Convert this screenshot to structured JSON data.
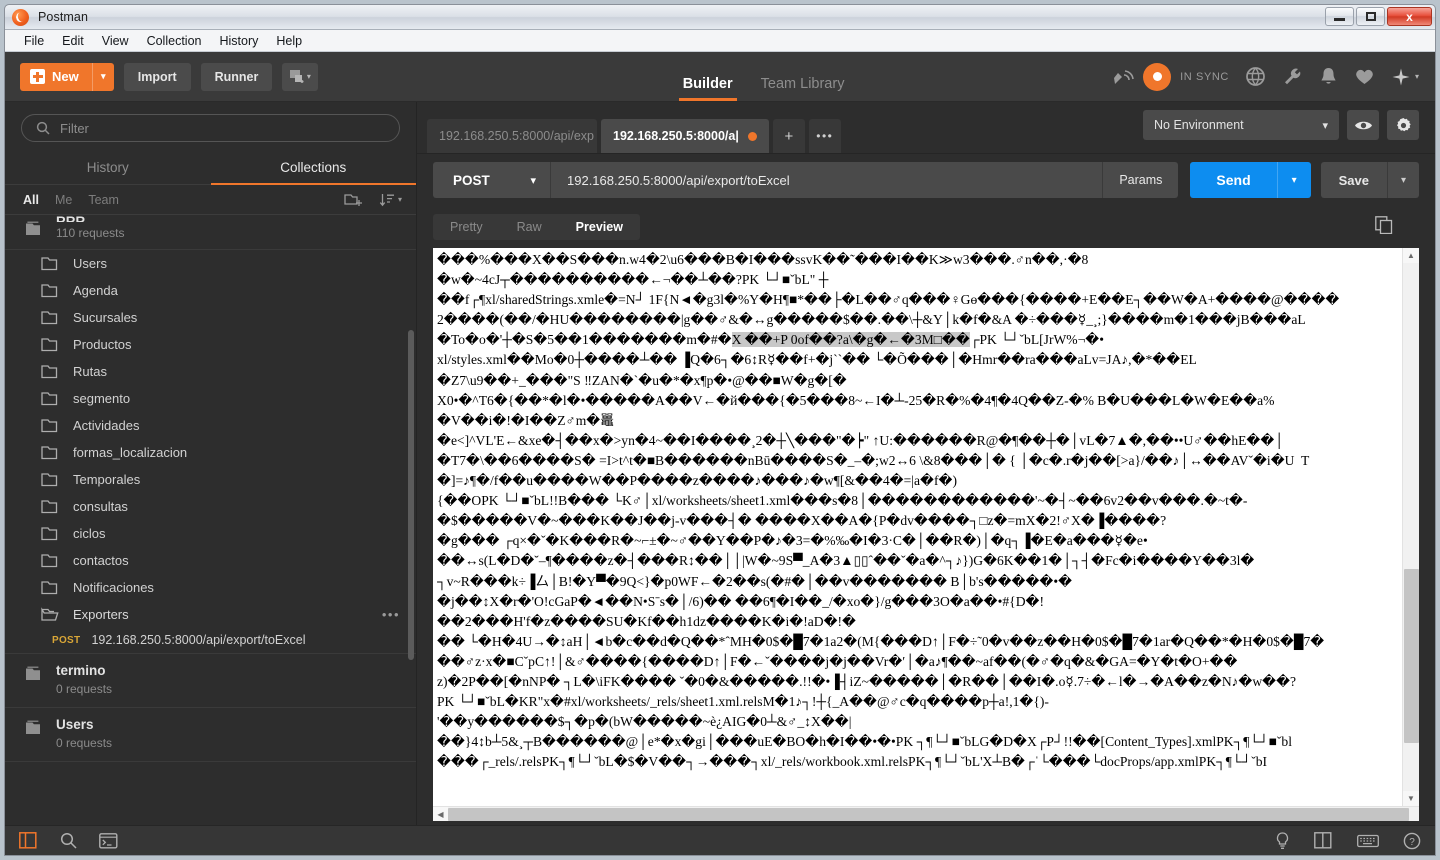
{
  "window": {
    "title": "Postman",
    "app_icon": "postman-logo-icon",
    "controls": {
      "minimize": "minimize-icon",
      "maximize": "restore-icon",
      "close": "x"
    }
  },
  "menubar": {
    "items": [
      "File",
      "Edit",
      "View",
      "Collection",
      "History",
      "Help"
    ]
  },
  "toolbar": {
    "new_label": "New",
    "new_caret": "▾",
    "import_label": "Import",
    "runner_label": "Runner",
    "tabs": [
      {
        "label": "Builder",
        "active": true
      },
      {
        "label": "Team Library",
        "active": false
      }
    ],
    "sync_status": "IN SYNC",
    "icons": [
      "satellite-icon",
      "sync-status-icon",
      "globe-icon",
      "wrench-icon",
      "bell-icon",
      "heart-icon",
      "upgrade-plus-icon"
    ]
  },
  "sidebar": {
    "filter_placeholder": "Filter",
    "tabs": [
      {
        "label": "History",
        "active": false
      },
      {
        "label": "Collections",
        "active": true
      }
    ],
    "scope_filters": [
      {
        "label": "All",
        "active": true
      },
      {
        "label": "Me",
        "active": false
      },
      {
        "label": "Team",
        "active": false
      }
    ],
    "header_icons": [
      "new-folder-icon",
      "sort-icon"
    ],
    "collections": [
      {
        "name": "RRR",
        "meta": "110 requests",
        "clipped": true,
        "folders": [
          "Users",
          "Agenda",
          "Sucursales",
          "Productos",
          "Rutas",
          "segmento",
          "Actividades",
          "formas_localizacion",
          "Temporales",
          "consultas",
          "ciclos",
          "contactos",
          "Notificaciones"
        ],
        "open_folder": {
          "name": "Exporters",
          "overflow": "•••",
          "requests": [
            {
              "method": "POST",
              "url": "192.168.250.5:8000/api/export/toExcel"
            }
          ]
        }
      },
      {
        "name": "termino",
        "meta": "0 requests",
        "folders": []
      },
      {
        "name": "Users",
        "meta": "0 requests",
        "folders": []
      }
    ]
  },
  "request_tabs": {
    "items": [
      {
        "label": "192.168.250.5:8000/api/exp",
        "active": false,
        "unsaved": false
      },
      {
        "label": "192.168.250.5:8000/a|",
        "active": true,
        "unsaved": true
      }
    ],
    "add_label": "+",
    "more_label": "•••"
  },
  "environment": {
    "selected": "No Environment",
    "caret": "⌄",
    "eye_icon": "eye-icon",
    "gear_icon": "gear-icon"
  },
  "request": {
    "method": "POST",
    "method_caret": "⌄",
    "url": "192.168.250.5:8000/api/export/toExcel",
    "params_label": "Params",
    "send_label": "Send",
    "send_caret": "⌄",
    "save_label": "Save",
    "save_caret": "⌄"
  },
  "response": {
    "view_tabs": [
      {
        "label": "Pretty",
        "active": false
      },
      {
        "label": "Raw",
        "active": false
      },
      {
        "label": "Preview",
        "active": true
      }
    ],
    "copy_icon": "copy-icon",
    "binary_lines": [
      "���%���X��S���n.w4�2\\u6���B�I���ssvK��˜���I��K≫w3���.♂n��,·�8",
      "�w�~4cJ┬����������←¬��┴��?PK └┘■ˇbL\" ┼",
      "��f┌¶xl/sharedStrings.xmle�=N┘ 1F{N◄�g3l�%Y�H¶■*��├�L��♂q���♀Gɵ���{����+E��E┐��W�A+����@����",
      "2����(��/�HU��������|g��♂&�↔g�����$��.��\\┼&Y│k�f�&A �÷���☿_¸;}����m�1���jB���aL",
      "�To�o�'┼�S�5��1�������m�#�<sel>X ��+P 0of��?a\\�g�←�3M□��</sel>┌PK └┘ˇbL[JrW%¬�•",
      "xl/styles.xml��Mo�0┼����┴�� ▐Q�6┐�6↕R☿��f+�j``�� └�Õ���│�Hmr��ra���aLv=JA♪,�*��EL",
      "�Z7\\u9��+_���\"S ‼ZAN�`�u�*�x¶p�•@��■W�g�[�",
      "X0•�^T6�{��*�l�•�����A��V←�й���{�5���8~←I�┴-25�R�%�4¶�4Q��Z-�% B�U���L�W�E��a%",
      "�V��i�!�I��Z♂m�鼉",
      "�e<]^VL'E←&xe�┤��x�>yn�4~��I����¸2�┼╲���\"�┝\" ↑U:������R@�¶��┼�│vL�7▲�,��••U♂��hE��│",
      "�T7�\\��6����S� =I>t^t�■B������nBū����S�_–�;w2↔6 \\&8���│� { │�c�.r�j��[>a}/��♪│↔��AVˇ�i�U  T",
      "�]=♪¶�/f��u����W��P����z����♪���♪�w¶[&��4�=|a�f�)",
      "{��OPK └┘■ˇbL!!B��� └K♂│xl/worksheets/sheet1.xml���s�8│������������'~�┤~��6v2��v���.�~t�-",
      "�$�����V�~���K��J��j-v���┤� ����X��A�{P�dv����┐□z�=mX�2!♂X�▐����?",
      "�g��� ┌q×�ˇ�K���R�~⌐±�~♂��Y��P�♪�3=�%‰�I�3·C�│��R�)│�q┐▐�E�a���☿�e•",
      "��↔s(L�D�˘–¶����z�┤���R↕��││|W�~9S▀_A�3▲▯▯ˆ��ˇ�a�^┐♪})G�6K��1�│┐┤�Fc�i����Y��3l�",
      "┐v~R���k÷▐厶│B!�Y▀�9Q<}�p0WF←�2��s(�#�│��v������� B│b's�����•�",
      "�j��↕X�r�'O!cGaP�◄��N•Sˉs�│/6)�� ��6¶�I��_/�xo�}/g���3O�a��•#{D�!",
      "��2���H'f�z����SU�Kf��h1dz����K�i�!aD�!�",
      "�� └�H�4U→�↕aH│◄b�c��d�Q��*ˆMH�0$�█7�1a2�(M{���D↑│F�÷˜0�v��z��H�0$�█7�1ar�Q��*�H�0$�█7�",
      "��♂z·x�■CˇpC↑!│&♂����{����D↑│F�←ˇ����j�j��Vr�′│�a♪¶��~af��(�♂�q�&�GA=�Y�t�O+��",
      "z)�2P��[�nNP� ┐L�\\iFK���� ˇ�0�&�����.!!�•▐┤iZ~�����│�R��│��I�.o☿.7÷�←l�→�A��z�N♪�w��?",
      "PK └┘■ˇbL�KR\"x�#xl/worksheets/_rels/sheet1.xml.relsM�1♪┐!┼{_A��@♂c�q����p┼a!,1�{)-",
      "'��y������$┐�p�(bW�����~è¿AIG�0┴&♂_↕X��|",
      "��}4↕b┴5&¸┬B������@│e*�x�gi│���uE�BO�h�I��•�•PK ┐¶└┘■ˇbLG�D�X┌P┘!!��[Content_Types].xmlPK┐¶└┘■ˇbl",
      "���┌_rels/.relsPK┐¶└┘ˇbL�$�V��┐→���┐xl/_rels/workbook.xml.relsPK┐¶└┘ˇbL'X┴B�┌ˈ└���└docProps/app.xmlPK┐¶└┘ˇbI"
    ]
  },
  "statusbar": {
    "left_icons": [
      "sidebar-toggle-icon",
      "search-icon",
      "console-icon"
    ],
    "right_icons": [
      "bulb-icon",
      "two-pane-layout-icon",
      "keyboard-icon",
      "help-icon"
    ]
  },
  "colors": {
    "accent_orange": "#f0762b",
    "send_blue": "#0d8df0",
    "method_post": "#d9a637",
    "panel_dark": "#2d2d2d",
    "toolbar_dark": "#3a3a3a",
    "control_grey": "#4a4a4a"
  }
}
